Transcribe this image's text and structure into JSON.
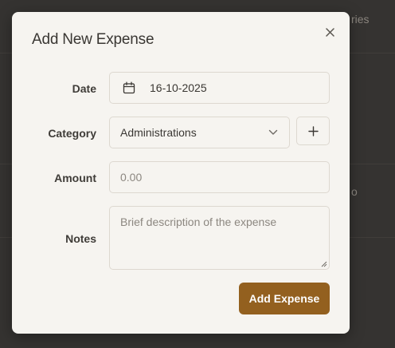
{
  "background": {
    "header_fragment": "ries",
    "row_fragment": "o"
  },
  "modal": {
    "title": "Add New Expense",
    "close_glyph": "×",
    "fields": {
      "date": {
        "label": "Date",
        "value": "16-10-2025"
      },
      "category": {
        "label": "Category",
        "value": "Administrations",
        "add_glyph": "+"
      },
      "amount": {
        "label": "Amount",
        "placeholder": "0.00"
      },
      "notes": {
        "label": "Notes",
        "placeholder": "Brief description of the expense"
      }
    },
    "submit_label": "Add Expense"
  },
  "colors": {
    "accent": "#93601f",
    "modal_bg": "#f6f4f0",
    "backdrop": "#353331"
  },
  "icons": [
    "close-icon",
    "calendar-icon",
    "chevron-down-icon",
    "plus-icon"
  ]
}
